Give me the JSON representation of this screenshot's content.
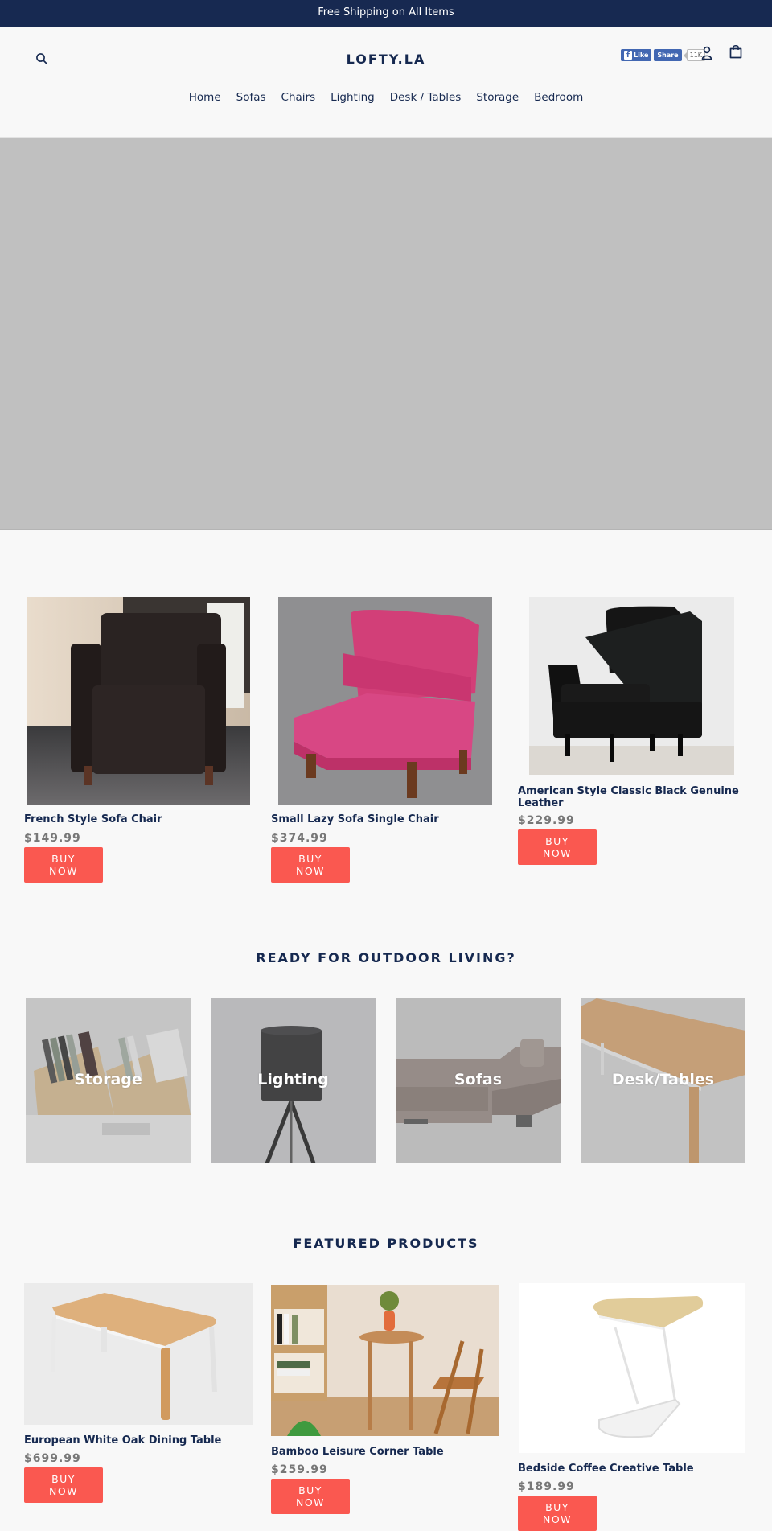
{
  "announcement": "Free Shipping on All Items",
  "header": {
    "logo": "LOFTY.LA",
    "search_icon": "search-icon",
    "account_icon": "account-icon",
    "cart_icon": "cart-icon",
    "facebook": {
      "like_label": "Like",
      "share_label": "Share",
      "count": "11K"
    }
  },
  "nav": [
    {
      "label": "Home"
    },
    {
      "label": "Sofas"
    },
    {
      "label": "Chairs"
    },
    {
      "label": "Lighting"
    },
    {
      "label": "Desk / Tables"
    },
    {
      "label": "Storage"
    },
    {
      "label": "Bedroom"
    }
  ],
  "buy_label": "BUY NOW",
  "top_products": [
    {
      "title": "French Style Sofa Chair",
      "price": "$149.99",
      "image": "dark-leather-armchair"
    },
    {
      "title": "Small Lazy Sofa Single Chair",
      "price": "$374.99",
      "image": "pink-fabric-chair"
    },
    {
      "title": "American Style Classic Black Genuine Leather",
      "price": "$229.99",
      "image": "black-tufted-leather-armchair"
    }
  ],
  "collections_section": {
    "title": "READY FOR OUTDOOR LIVING?",
    "items": [
      {
        "label": "Storage"
      },
      {
        "label": "Lighting"
      },
      {
        "label": "Sofas"
      },
      {
        "label": "Desk/Tables"
      }
    ]
  },
  "featured_section": {
    "title": "FEATURED PRODUCTS",
    "items": [
      {
        "title": "European White Oak Dining Table",
        "price": "$699.99",
        "image": "oak-dining-table"
      },
      {
        "title": "Bamboo Leisure Corner Table",
        "price": "$259.99",
        "image": "bamboo-corner-table"
      },
      {
        "title": "Bedside Coffee Creative Table",
        "price": "$189.99",
        "image": "bedside-c-table"
      }
    ]
  },
  "colors": {
    "navy": "#172951",
    "buy_button": "#fa5850",
    "price": "#777777",
    "hero_placeholder": "#c0c0c0"
  }
}
